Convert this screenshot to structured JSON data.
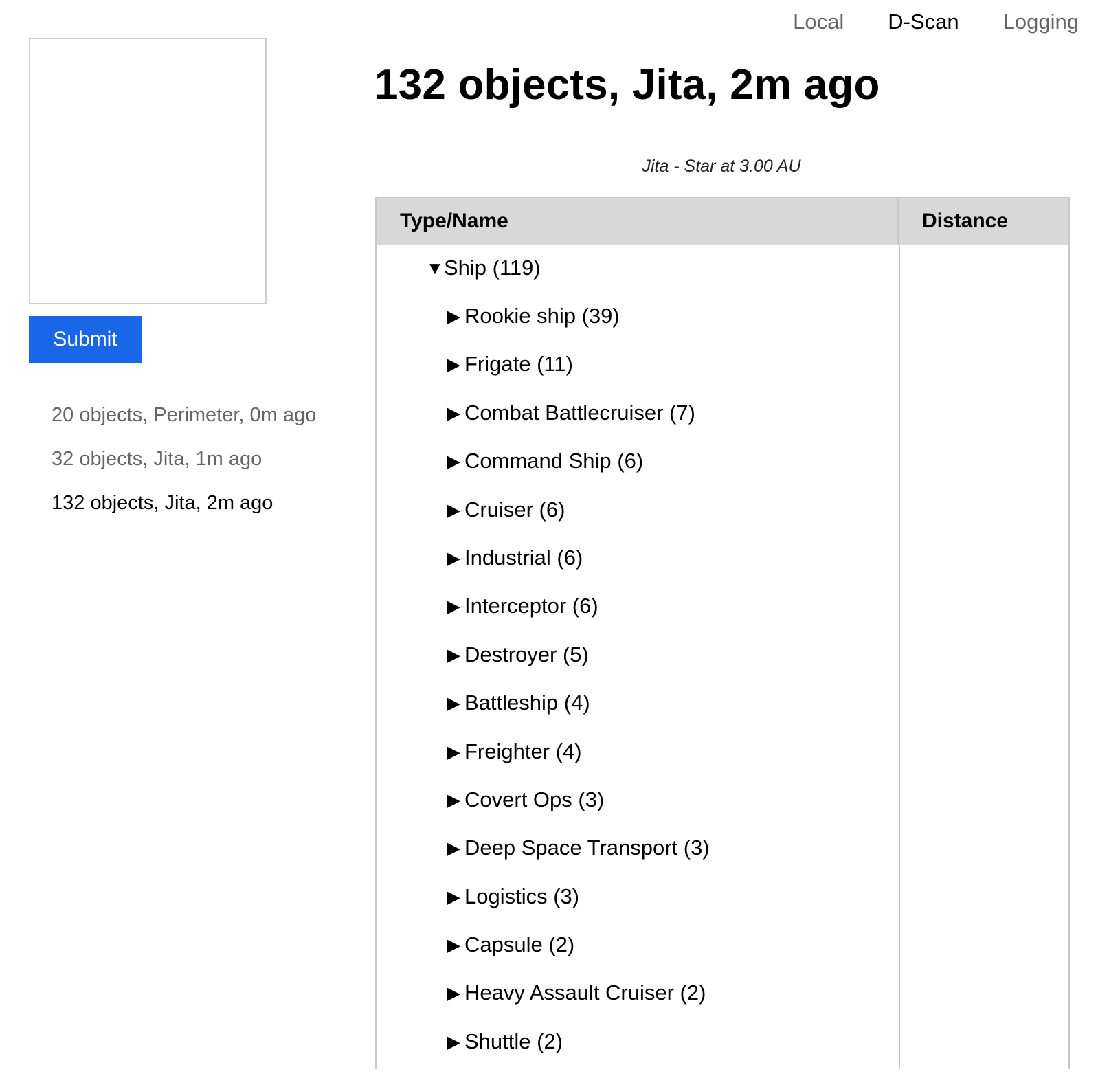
{
  "nav": {
    "local": "Local",
    "dscan": "D-Scan",
    "logging": "Logging"
  },
  "sidebar": {
    "submit_label": "Submit",
    "history": [
      "20 objects, Perimeter, 0m ago",
      "32 objects, Jita, 1m ago",
      "132 objects, Jita, 2m ago"
    ]
  },
  "scan": {
    "title": "132 objects, Jita, 2m ago",
    "subtitle": "Jita - Star at 3.00 AU",
    "columns": {
      "name": "Type/Name",
      "distance": "Distance"
    },
    "group": {
      "label": "Ship (119)",
      "expanded_icon": "triangle-down-icon"
    },
    "rows": [
      "Rookie ship (39)",
      "Frigate (11)",
      "Combat Battlecruiser (7)",
      "Command Ship (6)",
      "Cruiser (6)",
      "Industrial (6)",
      "Interceptor (6)",
      "Destroyer (5)",
      "Battleship (4)",
      "Freighter (4)",
      "Covert Ops (3)",
      "Deep Space Transport (3)",
      "Logistics (3)",
      "Capsule (2)",
      "Heavy Assault Cruiser (2)",
      "Shuttle (2)"
    ],
    "collapsed_icon": "triangle-right-icon"
  },
  "colors": {
    "submit_bg": "#1a66e8",
    "header_bg": "#d8d8d8",
    "muted_text": "#666666"
  }
}
